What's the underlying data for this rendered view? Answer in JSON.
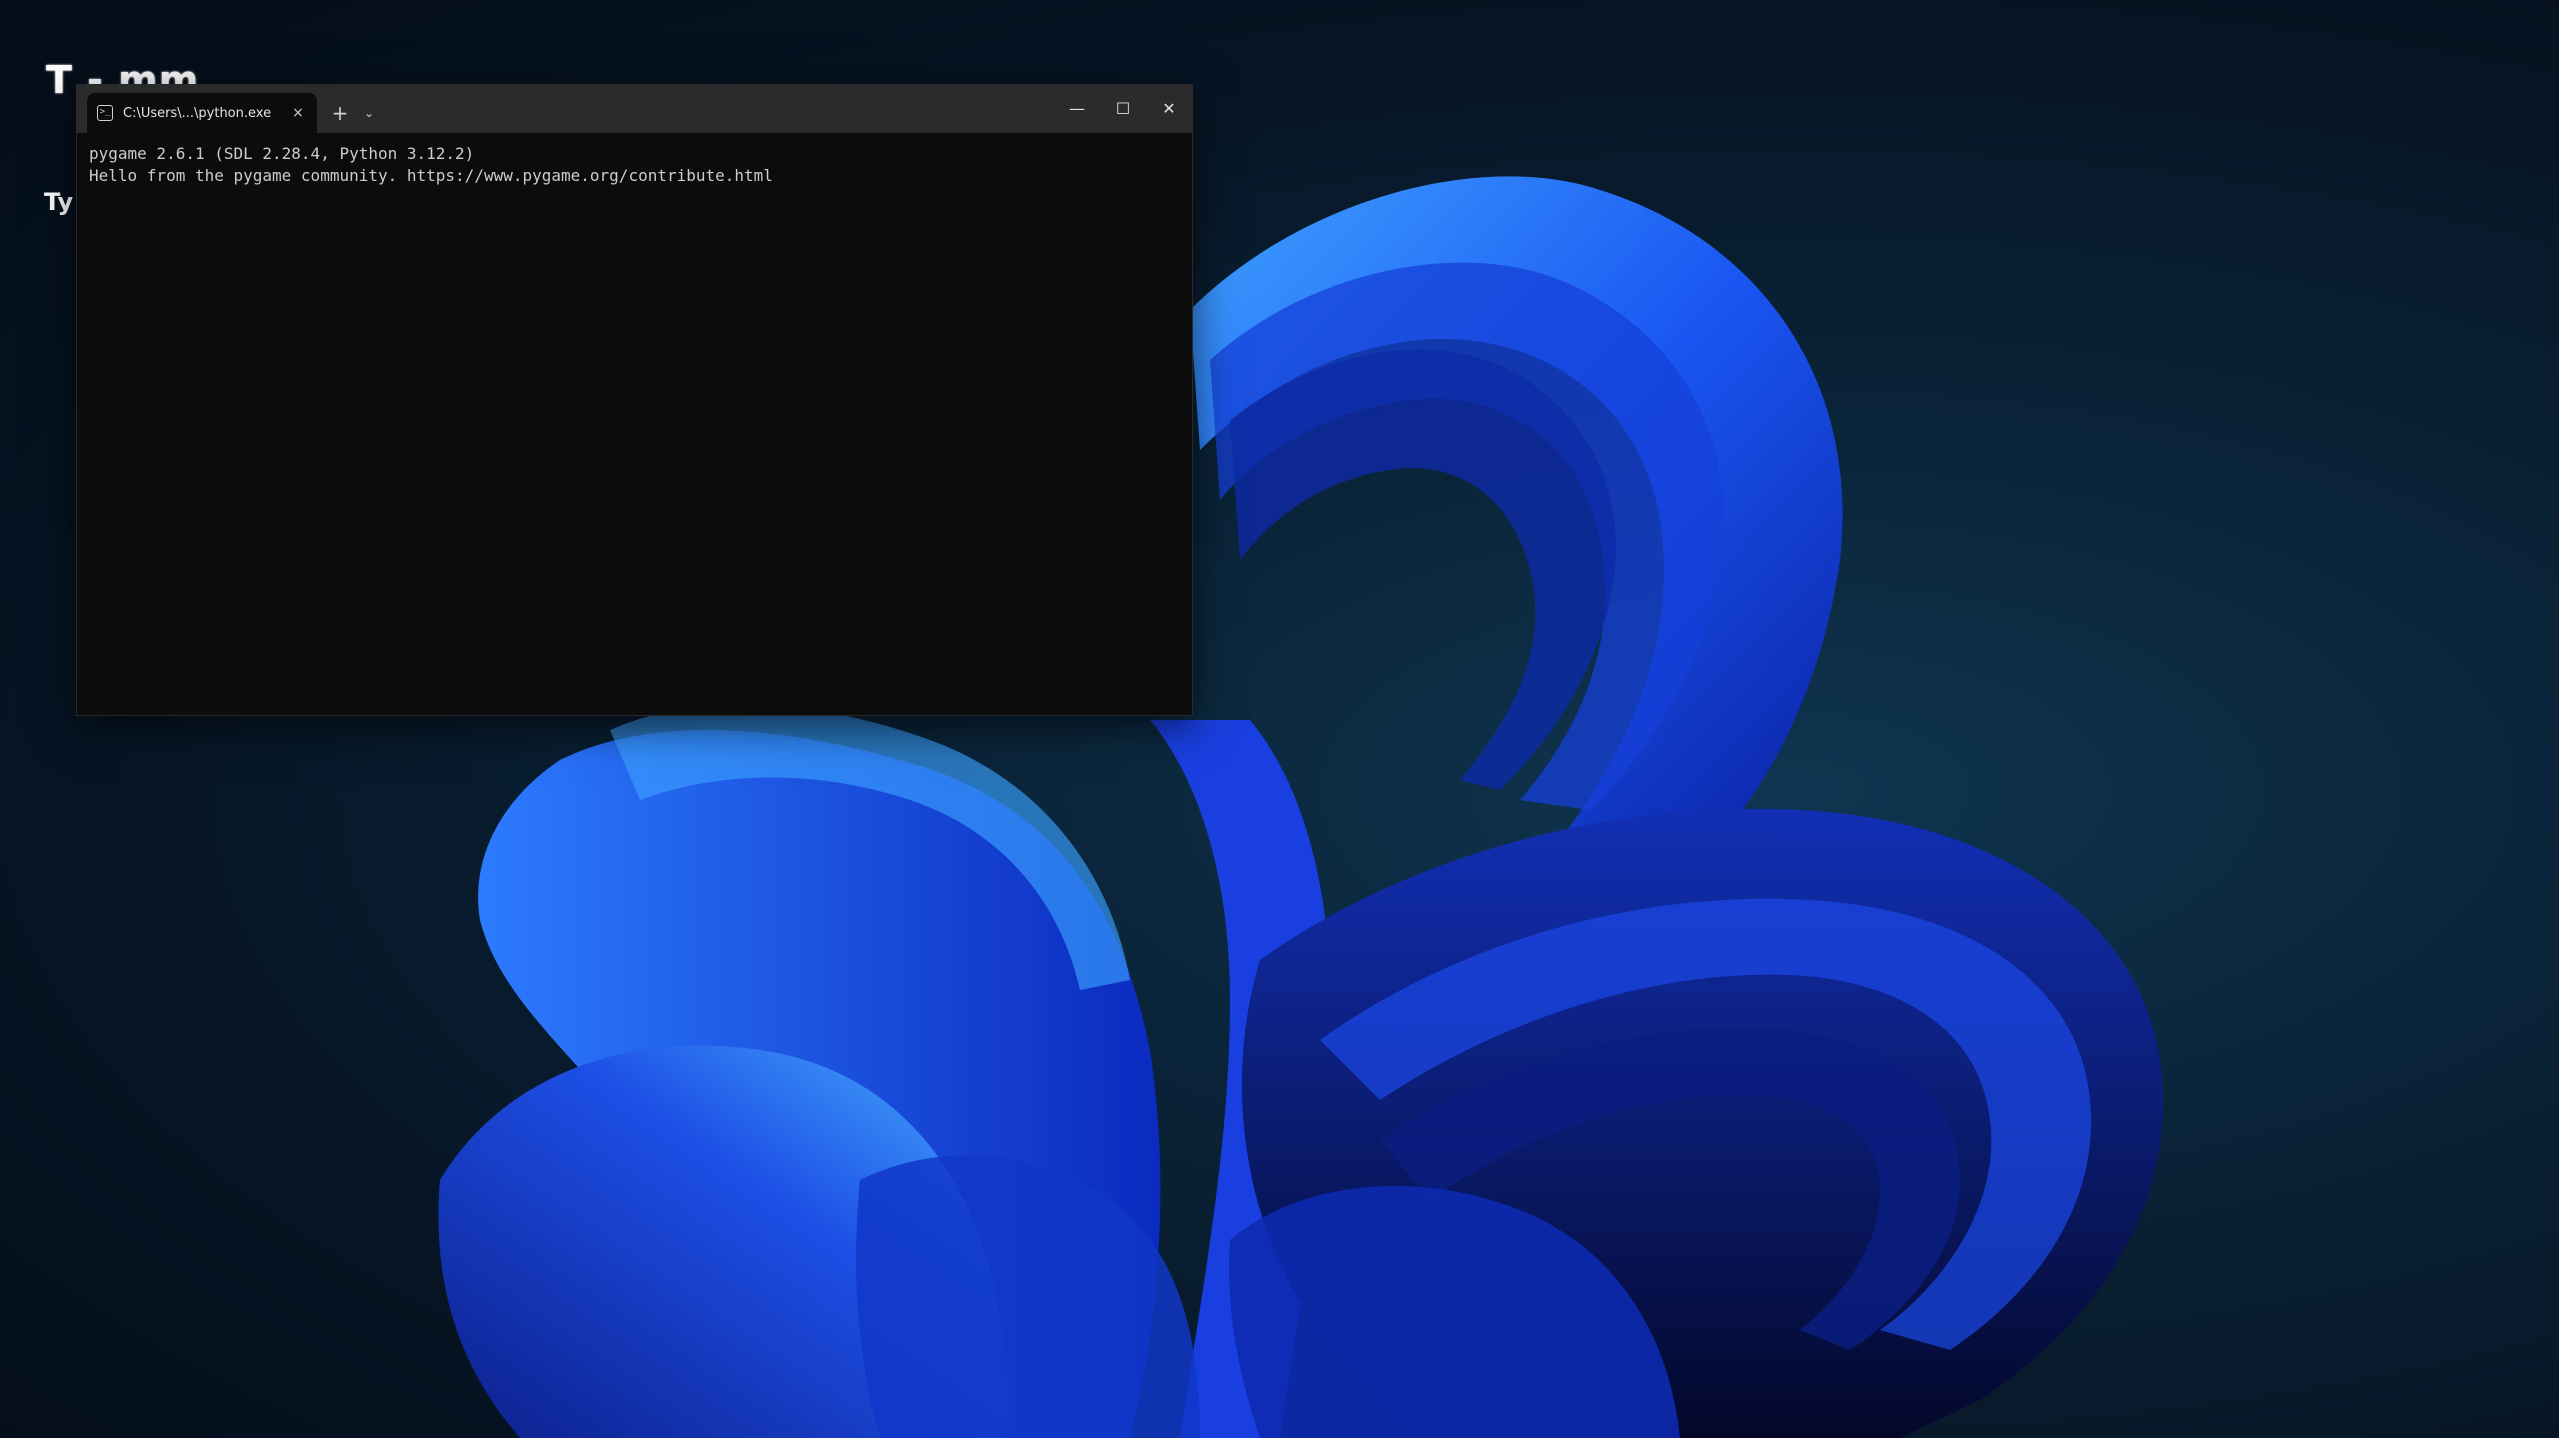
{
  "desktop": {
    "overlay_title": "T - mm",
    "overlay_sub": "Ty"
  },
  "terminal": {
    "tab_title": "C:\\Users\\...\\python.exe",
    "tab_close": "×",
    "new_tab": "+",
    "tab_dropdown": "⌄",
    "controls": {
      "minimize": "—",
      "maximize": "☐",
      "close": "✕"
    },
    "lines": [
      "pygame 2.6.1 (SDL 2.28.4, Python 3.12.2)",
      "Hello from the pygame community. https://www.pygame.org/contribute.html"
    ]
  },
  "colors": {
    "terminal_bg": "#0c0c0c",
    "titlebar_bg": "#2b2b2b",
    "wallpaper_blue": "#1f5fff"
  }
}
